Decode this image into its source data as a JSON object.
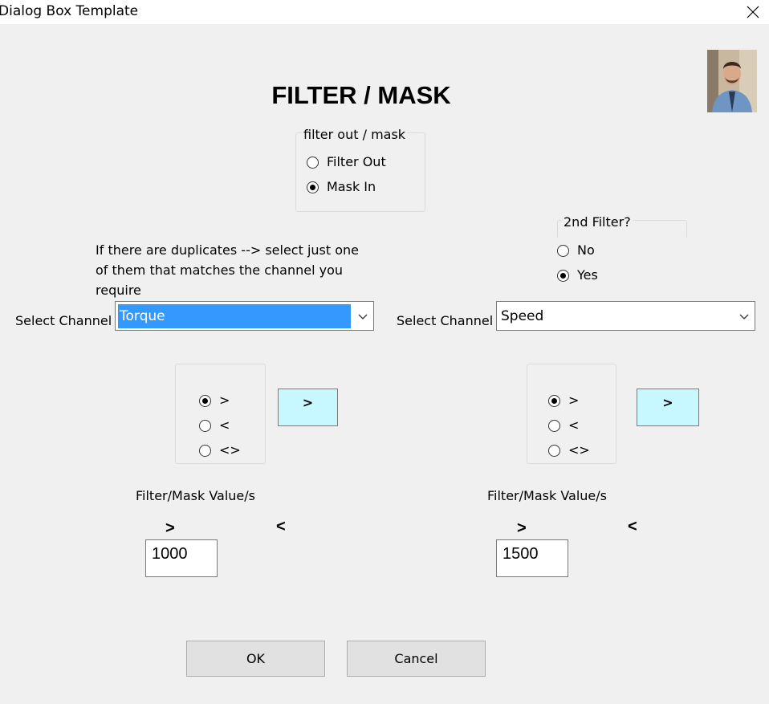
{
  "window": {
    "title": "Dialog Box Template"
  },
  "heading": "FILTER / MASK",
  "filter_group": {
    "legend": "filter out / mask",
    "options": [
      "Filter Out",
      "Mask In"
    ],
    "selected": "Mask In"
  },
  "second_filter_group": {
    "legend": "2nd Filter?",
    "options": [
      "No",
      "Yes"
    ],
    "selected": "Yes"
  },
  "duplicates_note": {
    "line1": "If there are duplicates --> select just one",
    "line2": "of them that matches the channel you",
    "line3": "require"
  },
  "left": {
    "select_label": "Select Channel",
    "channel_value": "Torque",
    "operators": [
      ">",
      "<",
      "<>"
    ],
    "selected_operator": ">",
    "operator_button": ">",
    "value_label": "Filter/Mask Value/s",
    "greater_symbol": ">",
    "less_symbol": "<",
    "value": "1000"
  },
  "right": {
    "select_label": "Select Channel",
    "channel_value": "Speed",
    "operators": [
      ">",
      "<",
      "<>"
    ],
    "selected_operator": ">",
    "operator_button": ">",
    "value_label": "Filter/Mask Value/s",
    "greater_symbol": ">",
    "less_symbol": "<",
    "value": "1500"
  },
  "buttons": {
    "ok": "OK",
    "cancel": "Cancel"
  },
  "colors": {
    "selection": "#3399ff",
    "operator_button_bg": "#c8f8ff",
    "dialog_bg": "#f0f0f0"
  },
  "icons": {
    "close": "close-icon",
    "dropdown": "chevron-down-icon",
    "avatar": "user-photo"
  }
}
